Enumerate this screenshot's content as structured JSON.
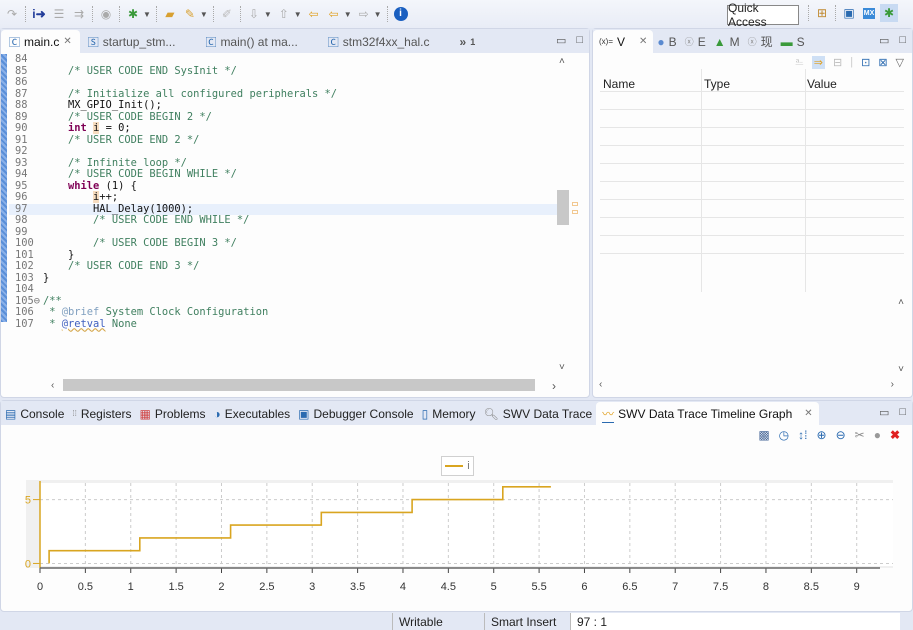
{
  "toolbar": {
    "icons": [
      "redo-icon",
      "skip-icon",
      "step-into-icon",
      "step-over-icon",
      "step-return-icon",
      "suspend-icon",
      "debug-icon",
      "open-folder-icon",
      "pen-icon",
      "edit-icon",
      "annotation-icon",
      "nav-icon",
      "back-icon",
      "prev-icon",
      "forward-icon",
      "info-icon"
    ],
    "quick_access": "Quick Access"
  },
  "editor": {
    "tabs": [
      {
        "label": "main.c",
        "active": true,
        "closable": true
      },
      {
        "label": "startup_stm...",
        "active": false
      },
      {
        "label": "main() at ma...",
        "active": false
      },
      {
        "label": "stm32f4xx_hal.c",
        "active": false
      }
    ],
    "overflow": "»",
    "overflow_count": "1",
    "lines": [
      {
        "n": "84",
        "html": ""
      },
      {
        "n": "85",
        "html": "    <span class=\"cm\">/* USER CODE END SysInit */</span>"
      },
      {
        "n": "86",
        "html": ""
      },
      {
        "n": "87",
        "html": "    <span class=\"cm\">/* Initialize all configured peripherals */</span>"
      },
      {
        "n": "88",
        "html": "    MX_GPIO_Init();"
      },
      {
        "n": "89",
        "html": "    <span class=\"cm\">/* USER CODE BEGIN 2 */</span>"
      },
      {
        "n": "90",
        "html": "    <span class=\"kw\">int</span> <span class=\"hl\">i</span> = 0;"
      },
      {
        "n": "91",
        "html": "    <span class=\"cm\">/* USER CODE END 2 */</span>"
      },
      {
        "n": "92",
        "html": ""
      },
      {
        "n": "93",
        "html": "    <span class=\"cm\">/* Infinite loop */</span>"
      },
      {
        "n": "94",
        "html": "    <span class=\"cm\">/* USER CODE BEGIN WHILE */</span>"
      },
      {
        "n": "95",
        "html": "    <span class=\"kw\">while</span> (1) {"
      },
      {
        "n": "96",
        "html": "        <span class=\"hl\">i</span>++;"
      },
      {
        "n": "97",
        "html": "        HAL_Delay(1000);",
        "current": true
      },
      {
        "n": "98",
        "html": "        <span class=\"cm\">/* USER CODE END WHILE */</span>"
      },
      {
        "n": "99",
        "html": ""
      },
      {
        "n": "100",
        "html": "        <span class=\"cm\">/* USER CODE BEGIN 3 */</span>"
      },
      {
        "n": "101",
        "html": "    }"
      },
      {
        "n": "102",
        "html": "    <span class=\"cm\">/* USER CODE END 3 */</span>"
      },
      {
        "n": "103",
        "html": "}"
      },
      {
        "n": "104",
        "html": ""
      },
      {
        "n": "105⊖",
        "html": "<span class=\"cm\">/**</span>"
      },
      {
        "n": "106",
        "html": "<span class=\"cm\"> * <span style=\"color:#7f9fbf\">@brief</span> System Clock Configuration</span>"
      },
      {
        "n": "107",
        "html": "<span class=\"cm\"> * <span class=\"ann\">@retval</span> None</span>"
      }
    ]
  },
  "variables": {
    "tabs": [
      {
        "label": "V",
        "prefix": "(x)=",
        "active": true,
        "closable": true
      },
      {
        "label": "B",
        "active": false
      },
      {
        "label": "E",
        "active": false
      },
      {
        "label": "M",
        "active": false
      },
      {
        "label": "现",
        "active": false
      },
      {
        "label": "S",
        "active": false
      }
    ],
    "columns": [
      "Name",
      "Type",
      "Value"
    ]
  },
  "bottom": {
    "tabs": [
      {
        "label": "Console",
        "icon": "console-icon"
      },
      {
        "label": "Registers",
        "icon": "registers-icon"
      },
      {
        "label": "Problems",
        "icon": "problems-icon"
      },
      {
        "label": "Executables",
        "icon": "executables-icon"
      },
      {
        "label": "Debugger Console",
        "icon": "debugger-console-icon"
      },
      {
        "label": "Memory",
        "icon": "memory-icon"
      },
      {
        "label": "SWV Data Trace",
        "icon": "search-icon"
      },
      {
        "label": "SWV Data Trace Timeline Graph",
        "icon": "graph-icon",
        "active": true,
        "closable": true
      }
    ],
    "graph_tools": [
      "snapshot-icon",
      "clock-icon",
      "scale-icon",
      "zoom-in-icon",
      "zoom-out-icon",
      "settings-icon",
      "record-icon",
      "stop-icon"
    ]
  },
  "chart_data": {
    "type": "line",
    "step": true,
    "title": "",
    "xlabel": "",
    "ylabel": "",
    "legend": {
      "entries": [
        "i"
      ],
      "placement": "top-center"
    },
    "series": [
      {
        "name": "i",
        "color": "#d9a520",
        "x": [
          0.1,
          0.1,
          1.1,
          1.1,
          2.1,
          2.1,
          3.1,
          3.1,
          4.1,
          4.1,
          5.1,
          5.1,
          5.63
        ],
        "y": [
          0,
          1,
          1,
          2,
          2,
          3,
          3,
          4,
          4,
          5,
          5,
          6,
          6
        ]
      }
    ],
    "xlim": [
      0,
      9.4
    ],
    "ylim": [
      -0.2,
      6.3
    ],
    "xticks": [
      "0",
      "0.5",
      "1",
      "1.5",
      "2",
      "2.5",
      "3",
      "3.5",
      "4",
      "4.5",
      "5",
      "5.5",
      "6",
      "6.5",
      "7",
      "7.5",
      "8",
      "8.5",
      "9"
    ],
    "xtick_values": [
      0,
      0.5,
      1,
      1.5,
      2,
      2.5,
      3,
      3.5,
      4,
      4.5,
      5,
      5.5,
      6,
      6.5,
      7,
      7.5,
      8,
      8.5,
      9
    ],
    "yticks": [
      "0",
      "5"
    ],
    "ytick_values": [
      0,
      5
    ],
    "grid": true
  },
  "statusbar": {
    "writable": "Writable",
    "insert_mode": "Smart Insert",
    "position": "97 : 1"
  }
}
